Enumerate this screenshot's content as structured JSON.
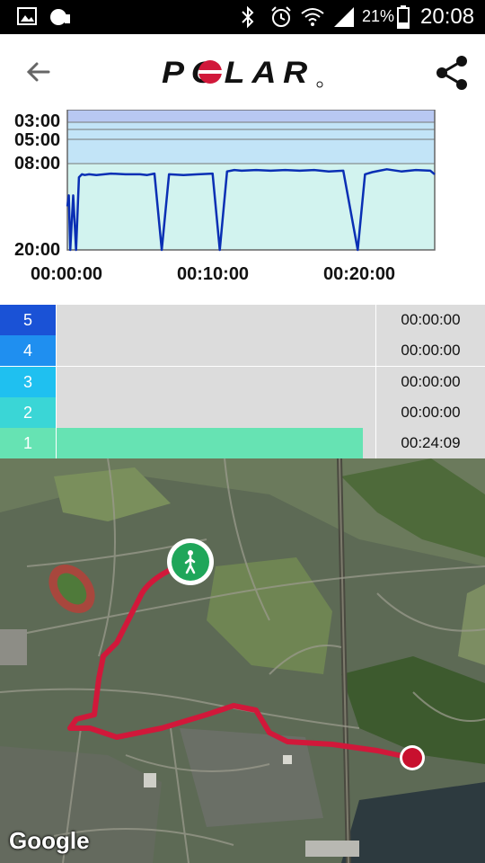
{
  "status_bar": {
    "battery": "21%",
    "time": "20:08"
  },
  "header": {
    "logo_text": "POLAR",
    "back_icon": "arrow-back-icon",
    "share_icon": "share-icon"
  },
  "chart_data": {
    "type": "line",
    "y_tick_labels": [
      "03:00",
      "05:00",
      "08:00",
      "20:00"
    ],
    "x_tick_labels": [
      "00:00:00",
      "00:10:00",
      "00:20:00"
    ],
    "zone_band_colors": [
      "#b8c8f2",
      "#c2e4f7",
      "#d2f3ef"
    ],
    "series": [
      {
        "color": "#0a2fb4",
        "x_minutes": [
          0,
          0.1,
          0.2,
          0.4,
          0.6,
          0.8,
          1.0,
          1.2,
          1.5,
          2,
          3,
          4,
          5,
          5.5,
          6,
          6.5,
          7,
          8,
          9,
          10,
          10.5,
          11,
          11.5,
          12,
          13,
          14,
          15,
          16,
          17,
          18,
          19,
          20,
          20.5,
          21,
          21.5,
          22,
          23,
          24,
          25,
          25.3
        ],
        "y_pace_min": [
          14,
          12.5,
          20,
          12.5,
          20,
          10,
          9.6,
          9.7,
          9.6,
          9.7,
          9.5,
          9.6,
          9.6,
          9.7,
          9.5,
          20,
          9.6,
          9.7,
          9.6,
          9.5,
          20,
          9.2,
          9.0,
          9.1,
          9.0,
          9.1,
          9.0,
          9.1,
          9.0,
          9.2,
          9.1,
          20,
          9.6,
          9.3,
          9.1,
          8.9,
          9.2,
          9.0,
          9.1,
          9.6
        ]
      }
    ]
  },
  "zones": [
    {
      "number": "5",
      "time": "00:00:00",
      "fill_fraction": 0,
      "color": "#1a52d6"
    },
    {
      "number": "4",
      "time": "00:00:00",
      "fill_fraction": 0,
      "color": "#1f8ff0"
    },
    {
      "number": "3",
      "time": "00:00:00",
      "fill_fraction": 0,
      "color": "#1fc0f0"
    },
    {
      "number": "2",
      "time": "00:00:00",
      "fill_fraction": 0,
      "color": "#3ad6d6"
    },
    {
      "number": "1",
      "time": "00:24:09",
      "fill_fraction": 0.96,
      "color": "#66e3b3"
    }
  ],
  "map": {
    "attribution": "Google",
    "start_icon": "walking-person-icon",
    "route_color": "#d1183a"
  }
}
